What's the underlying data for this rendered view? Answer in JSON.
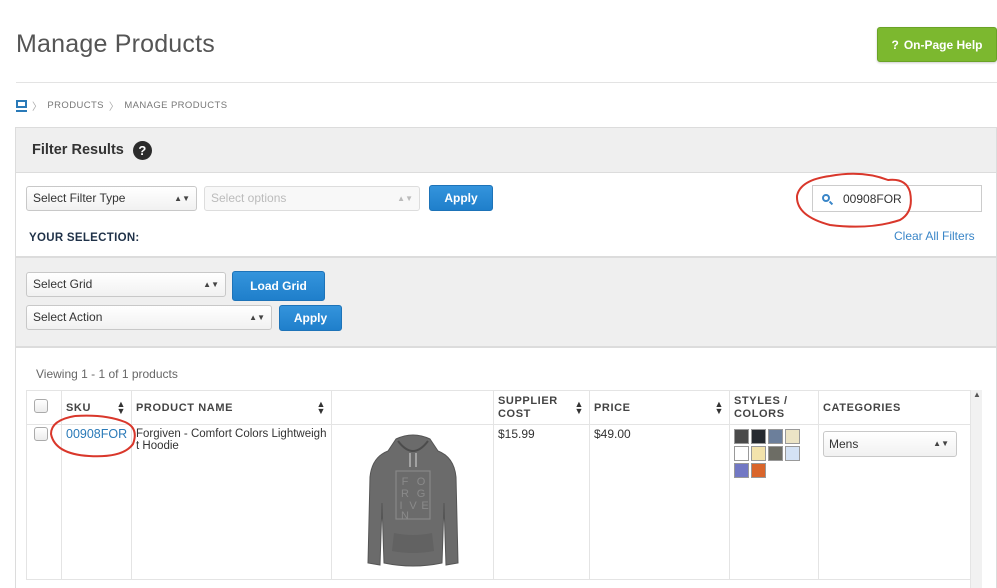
{
  "header": {
    "title": "Manage Products",
    "help_label": "On-Page Help",
    "help_mark": "?"
  },
  "breadcrumb": {
    "items": [
      "PRODUCTS",
      "MANAGE PRODUCTS"
    ],
    "separator": "〉"
  },
  "filter": {
    "heading": "Filter Results",
    "help_mark": "?",
    "filter_type_label": "Select Filter Type",
    "options_placeholder": "Select options",
    "apply_label": "Apply",
    "search_value": "00908FOR",
    "your_selection_label": "YOUR SELECTION:",
    "clear_all_label": "Clear All Filters"
  },
  "grid": {
    "select_grid_label": "Select Grid",
    "load_grid_label": "Load Grid",
    "select_action_label": "Select Action",
    "apply_label": "Apply"
  },
  "products": {
    "viewing_text": "Viewing 1 - 1 of 1 products",
    "columns": {
      "sku": "SKU",
      "product_name": "PRODUCT NAME",
      "supplier_cost": "SUPPLIER COST",
      "price": "PRICE",
      "styles_colors": "STYLES / COLORS",
      "categories": "CATEGORIES"
    },
    "rows": [
      {
        "sku": "00908FOR",
        "name": "Forgiven - Comfort Colors Lightweight Hoodie",
        "supplier_cost": "$15.99",
        "price": "$49.00",
        "category": "Mens",
        "image_letters": [
          "F",
          "O",
          "R",
          "G",
          "I",
          "V",
          "E",
          "N"
        ],
        "swatches": [
          "#4a4a4a",
          "#262a30",
          "#6c7f9b",
          "#ece4c6",
          "#ffffff",
          "#f3e3ac",
          "#6d6d65",
          "#d4e2f4",
          "#7278c4",
          "#d9652b"
        ]
      }
    ]
  },
  "colors": {
    "accent_green": "#7cb82f",
    "accent_blue": "#2a7ab8",
    "annotation_red": "#d9372b",
    "hoodie_gray": "#6b6b6b"
  }
}
